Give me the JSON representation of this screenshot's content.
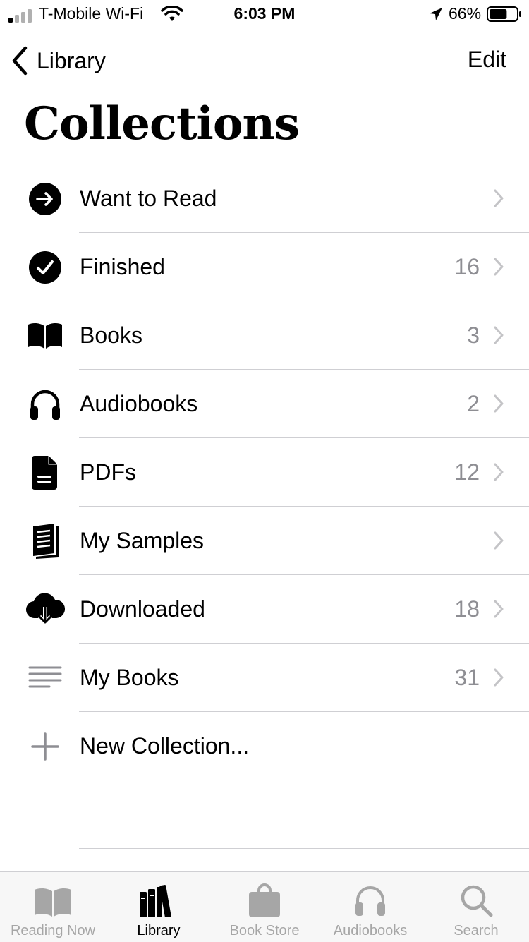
{
  "status_bar": {
    "carrier": "T-Mobile Wi-Fi",
    "time": "6:03 PM",
    "battery": "66%",
    "battery_level": 0.66
  },
  "nav": {
    "back_label": "Library",
    "edit_label": "Edit"
  },
  "title": "Collections",
  "collections": [
    {
      "label": "Want to Read",
      "count": "",
      "icon": "arrow-circle-icon"
    },
    {
      "label": "Finished",
      "count": "16",
      "icon": "checkmark-circle-icon"
    },
    {
      "label": "Books",
      "count": "3",
      "icon": "open-book-icon"
    },
    {
      "label": "Audiobooks",
      "count": "2",
      "icon": "headphones-icon"
    },
    {
      "label": "PDFs",
      "count": "12",
      "icon": "document-icon"
    },
    {
      "label": "My Samples",
      "count": "",
      "icon": "samples-icon"
    },
    {
      "label": "Downloaded",
      "count": "18",
      "icon": "cloud-download-icon"
    },
    {
      "label": "My Books",
      "count": "31",
      "icon": "lines-icon"
    }
  ],
  "new_collection": {
    "label": "New Collection...",
    "icon": "plus-icon"
  },
  "tabs": [
    {
      "label": "Reading Now",
      "icon": "open-book-icon",
      "active": false
    },
    {
      "label": "Library",
      "icon": "library-icon",
      "active": true
    },
    {
      "label": "Book Store",
      "icon": "shopping-bag-icon",
      "active": false
    },
    {
      "label": "Audiobooks",
      "icon": "headphones-icon",
      "active": false
    },
    {
      "label": "Search",
      "icon": "search-icon",
      "active": false
    }
  ],
  "colors": {
    "accent": "#000000",
    "secondary_text": "#8e8e93",
    "inactive_tab": "#a6a6a6",
    "separator": "#cfcfd3"
  }
}
